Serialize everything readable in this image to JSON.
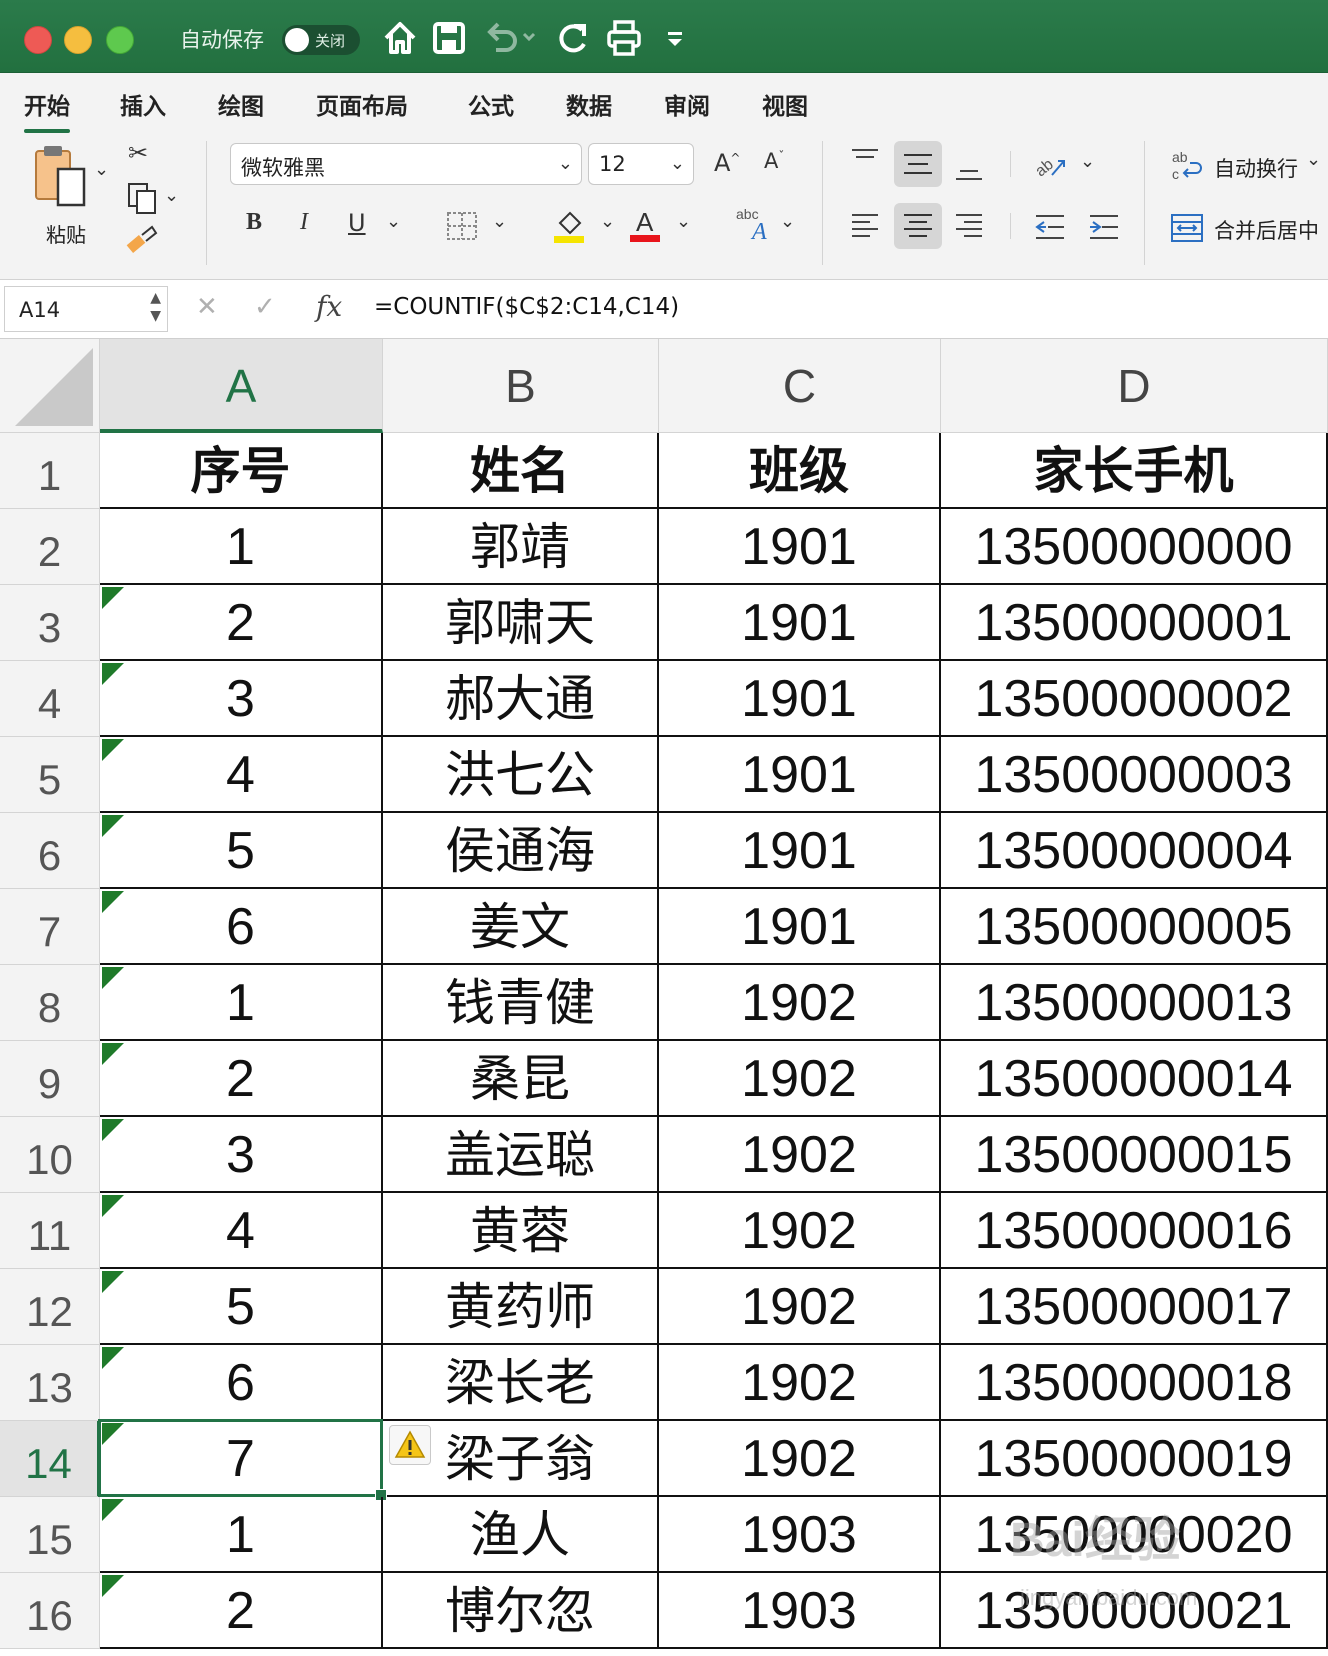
{
  "titlebar": {
    "autosave_label": "自动保存",
    "autosave_state": "关闭",
    "icons": [
      "home-icon",
      "save-icon",
      "undo-icon",
      "redo-icon",
      "print-icon",
      "customize-icon"
    ]
  },
  "ribbon": {
    "tabs": [
      "开始",
      "插入",
      "绘图",
      "页面布局",
      "公式",
      "数据",
      "审阅",
      "视图"
    ],
    "active_tab": "开始",
    "paste_label": "粘贴",
    "font_name": "微软雅黑",
    "font_size": "12",
    "bold": "B",
    "italic": "I",
    "underline": "U",
    "wrap_text": "自动换行",
    "merge_center": "合并后居中",
    "font_color": "#e8141b",
    "highlight_color": "#f5e400"
  },
  "formula_bar": {
    "name_box": "A14",
    "fx": "fx",
    "formula": "=COUNTIF($C$2:C14,C14)"
  },
  "sheet": {
    "columns": [
      "A",
      "B",
      "C",
      "D"
    ],
    "selected_column": "A",
    "selected_row": "14",
    "rows": [
      {
        "n": "1",
        "cells": [
          "序号",
          "姓名",
          "班级",
          "家长手机"
        ],
        "header": true,
        "flag": false
      },
      {
        "n": "2",
        "cells": [
          "1",
          "郭靖",
          "1901",
          "13500000000"
        ],
        "flag": false
      },
      {
        "n": "3",
        "cells": [
          "2",
          "郭啸天",
          "1901",
          "13500000001"
        ],
        "flag": true
      },
      {
        "n": "4",
        "cells": [
          "3",
          "郝大通",
          "1901",
          "13500000002"
        ],
        "flag": true
      },
      {
        "n": "5",
        "cells": [
          "4",
          "洪七公",
          "1901",
          "13500000003"
        ],
        "flag": true
      },
      {
        "n": "6",
        "cells": [
          "5",
          "侯通海",
          "1901",
          "13500000004"
        ],
        "flag": true
      },
      {
        "n": "7",
        "cells": [
          "6",
          "姜文",
          "1901",
          "13500000005"
        ],
        "flag": true
      },
      {
        "n": "8",
        "cells": [
          "1",
          "钱青健",
          "1902",
          "13500000013"
        ],
        "flag": true
      },
      {
        "n": "9",
        "cells": [
          "2",
          "桑昆",
          "1902",
          "13500000014"
        ],
        "flag": true
      },
      {
        "n": "10",
        "cells": [
          "3",
          "盖运聪",
          "1902",
          "13500000015"
        ],
        "flag": true
      },
      {
        "n": "11",
        "cells": [
          "4",
          "黄蓉",
          "1902",
          "13500000016"
        ],
        "flag": true
      },
      {
        "n": "12",
        "cells": [
          "5",
          "黄药师",
          "1902",
          "13500000017"
        ],
        "flag": true
      },
      {
        "n": "13",
        "cells": [
          "6",
          "梁长老",
          "1902",
          "13500000018"
        ],
        "flag": true
      },
      {
        "n": "14",
        "cells": [
          "7",
          "梁子翁",
          "1902",
          "13500000019"
        ],
        "flag": true
      },
      {
        "n": "15",
        "cells": [
          "1",
          "渔人",
          "1903",
          "13500000020"
        ],
        "flag": true
      },
      {
        "n": "16",
        "cells": [
          "2",
          "博尔忽",
          "1903",
          "13500000021"
        ],
        "flag": true
      }
    ]
  },
  "watermark": {
    "text": "Bai经验",
    "sub": "jingyan.baidu.com"
  }
}
